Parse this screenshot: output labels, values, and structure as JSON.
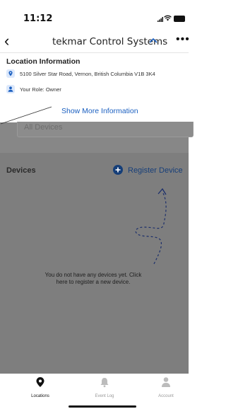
{
  "status_bar": {
    "time": "11:12"
  },
  "nav": {
    "title": "tekmar Control Systems"
  },
  "location_info": {
    "heading": "Location Information",
    "address": "5100 Silver Star Road, Vernon, British Columbia V1B 3K4",
    "role": "Your Role: Owner",
    "show_more": "Show More Information"
  },
  "search": {
    "value": "All Devices"
  },
  "devices": {
    "label": "Devices",
    "register": "Register Device",
    "empty_message": "You do not have any devices yet. Click here to register a new device."
  },
  "tabs": [
    {
      "label": "Locations",
      "icon": "location-pin-icon",
      "active": true
    },
    {
      "label": "Event Log",
      "icon": "bell-icon",
      "active": false
    },
    {
      "label": "Account",
      "icon": "person-icon",
      "active": false
    }
  ],
  "colors": {
    "accent": "#1a5fc0",
    "overlay": "#878787",
    "register_button": "#153e78"
  }
}
